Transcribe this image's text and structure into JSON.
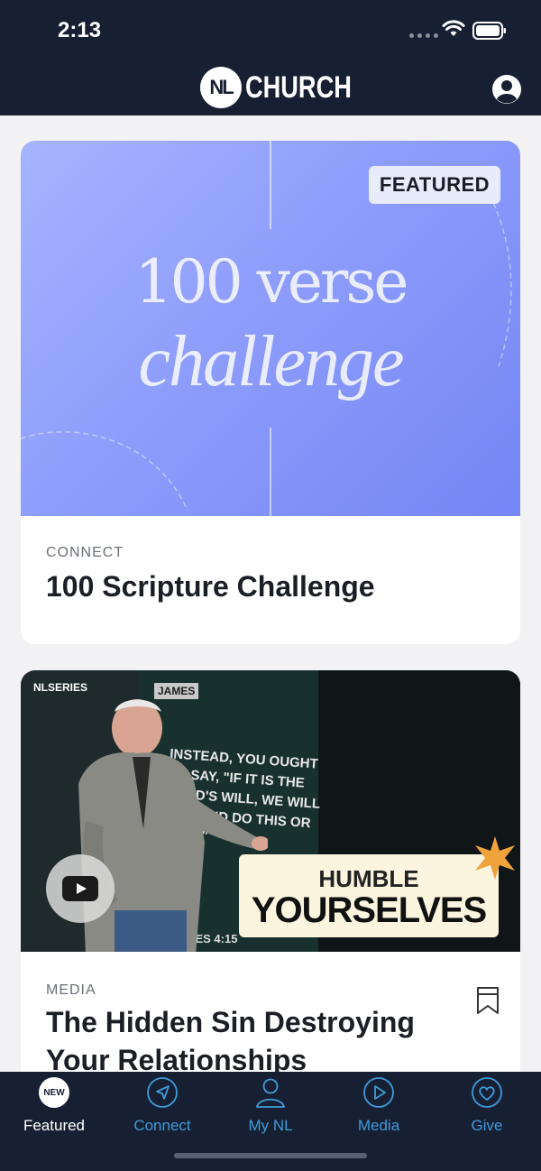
{
  "status_bar": {
    "time": "2:13"
  },
  "header": {
    "logo_badge": "NL",
    "logo_text": "CHURCH"
  },
  "cards": [
    {
      "badge": "FEATURED",
      "hero_line1": "100 verse",
      "hero_line2": "challenge",
      "category": "CONNECT",
      "title": "100 Scripture Challenge"
    },
    {
      "series_tag": "NLSERIES",
      "screen_tag": "JAMES",
      "verse": "INSTEAD, YOU OUGHT TO SAY, \"IF IT IS THE LORD'S WILL, WE WILL LIVE AND DO THIS OR THAT.\"",
      "verse_ref": "JAMES 4:15",
      "overlay_line1": "HUMBLE",
      "overlay_line2": "YOURSELVES",
      "category": "MEDIA",
      "title_line1": "The Hidden Sin Destroying",
      "title_line2": "Your Relationships"
    }
  ],
  "tabs": [
    {
      "label": "Featured",
      "badge": "NEW",
      "icon": "new-badge",
      "active": true
    },
    {
      "label": "Connect",
      "icon": "navigation-arrow-icon"
    },
    {
      "label": "My NL",
      "icon": "person-icon"
    },
    {
      "label": "Media",
      "icon": "play-icon"
    },
    {
      "label": "Give",
      "icon": "heart-icon"
    }
  ],
  "colors": {
    "header_bg": "#172033",
    "accent": "#3f9ad8",
    "page_bg": "#f2f2f4"
  }
}
